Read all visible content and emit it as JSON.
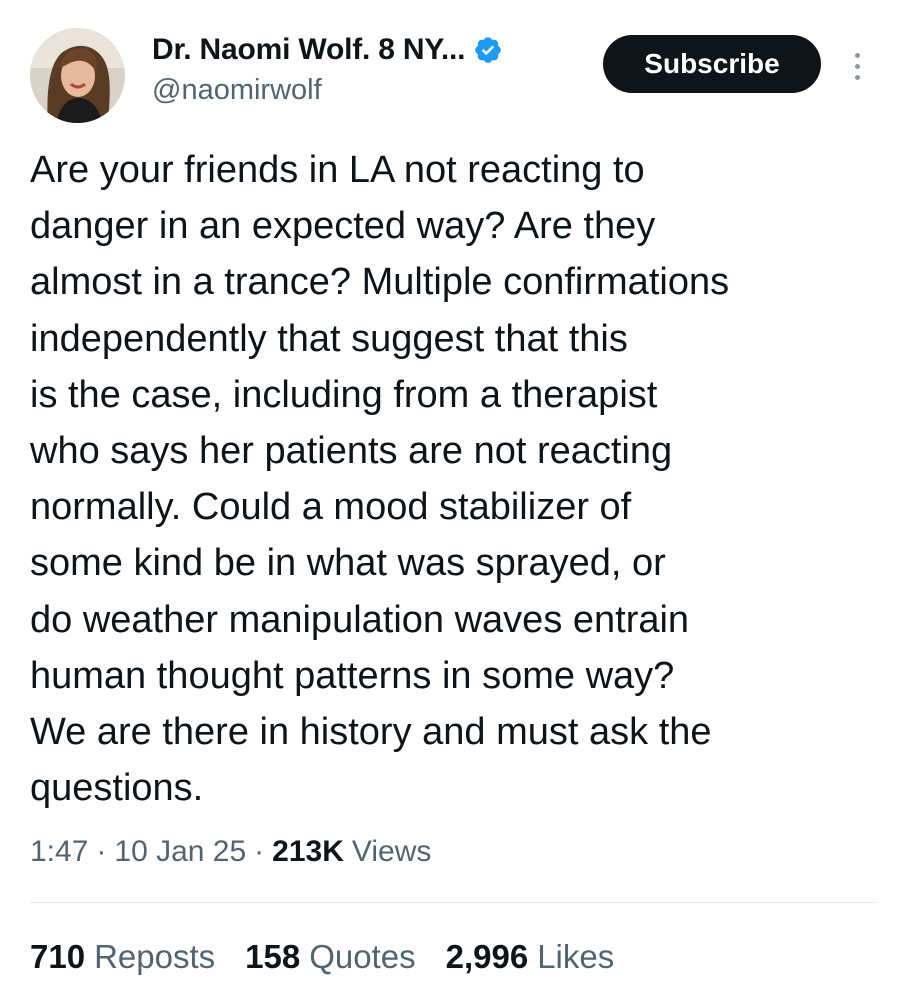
{
  "author": {
    "display_name": "Dr. Naomi Wolf. 8 NY...",
    "handle": "@naomirwolf",
    "verified_icon": "verified-badge-icon",
    "avatar_icon": "profile-photo"
  },
  "header": {
    "subscribe_label": "Subscribe",
    "more_icon": "more-options-icon"
  },
  "tweet": {
    "lines": [
      "Are your friends in LA not reacting to",
      "danger in an expected way? Are they",
      "almost in a trance? Multiple confirmations",
      "independently that suggest that this",
      "is the case, including from a therapist",
      "who says her patients are not reacting",
      "normally. Could a mood stabilizer of",
      "some kind be in what was sprayed, or",
      "do weather manipulation waves entrain",
      "human thought patterns in some way?",
      "We are there in history and must ask the",
      "questions."
    ]
  },
  "meta": {
    "time": "1:47",
    "separator": "·",
    "date": "10 Jan 25",
    "views_count": "213K",
    "views_label": "Views"
  },
  "stats": [
    {
      "count": "710",
      "label": "Reposts"
    },
    {
      "count": "158",
      "label": "Quotes"
    },
    {
      "count": "2,996",
      "label": "Likes"
    }
  ],
  "colors": {
    "text": "#0f1419",
    "secondary": "#536471",
    "verified": "#1d9bf0",
    "button_bg": "#0f1419",
    "divider": "#e6e9eb"
  }
}
